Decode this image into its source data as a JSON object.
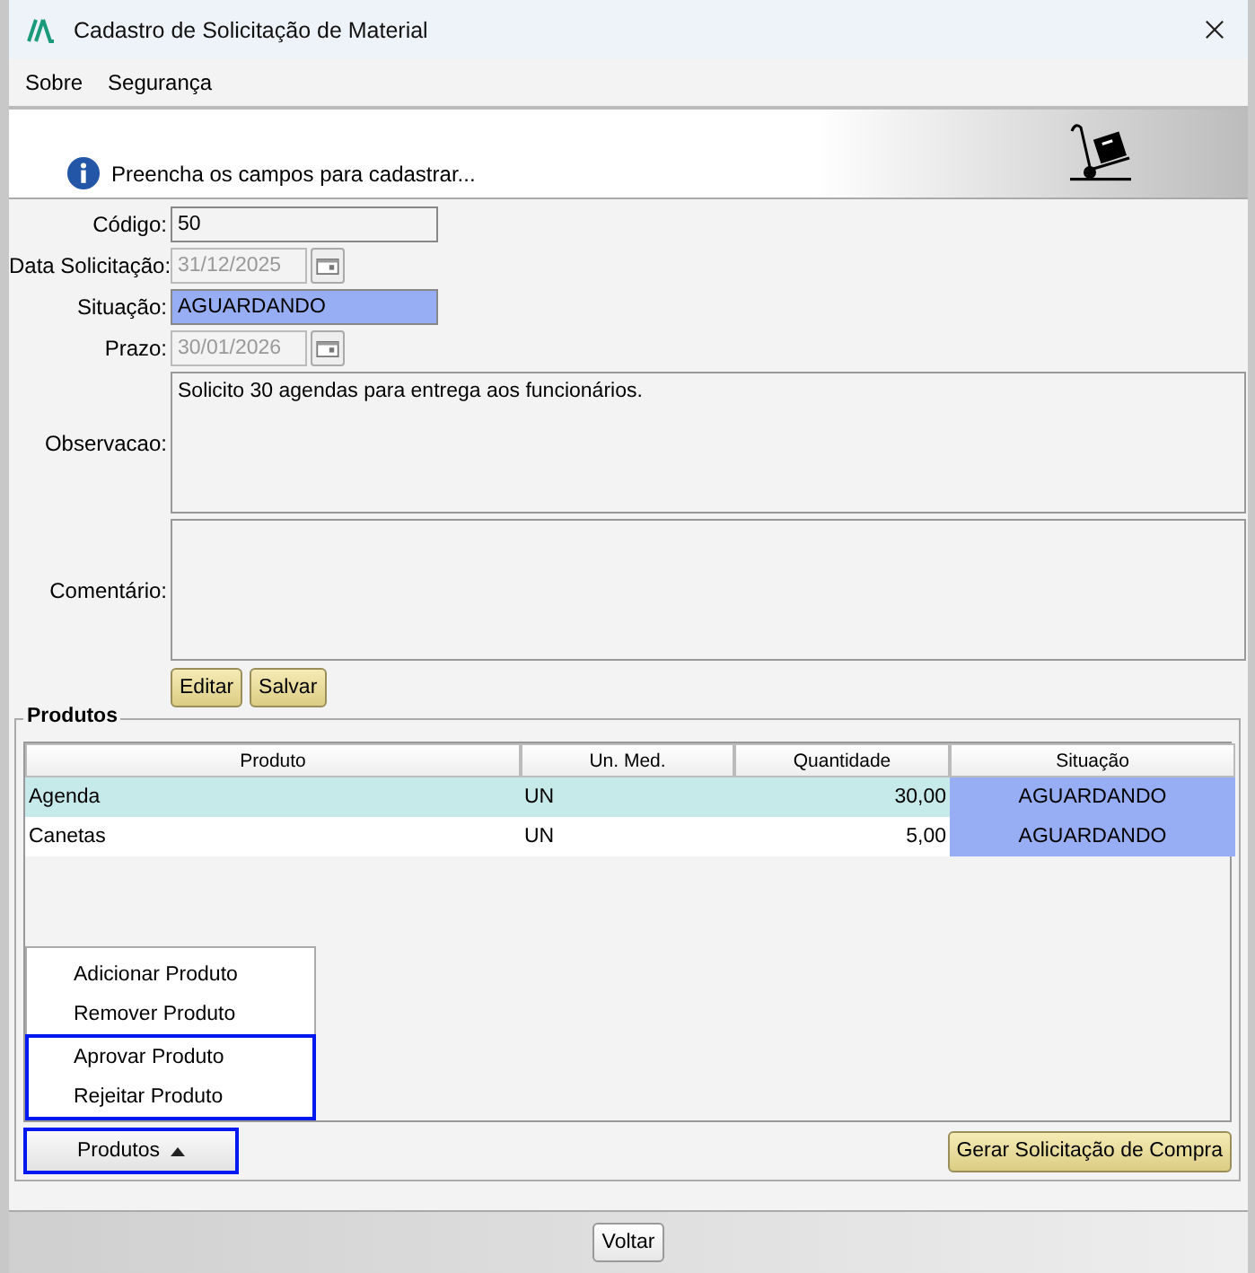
{
  "window": {
    "title": "Cadastro de Solicitação de Material"
  },
  "menu": [
    {
      "label": "Sobre"
    },
    {
      "label": "Segurança"
    }
  ],
  "banner": {
    "message": "Preencha os campos para cadastrar..."
  },
  "form": [
    {
      "label": "Código:",
      "value": "50",
      "kind": "text",
      "disabled": false
    },
    {
      "label": "Data Solicitação:",
      "value": "31/12/2025",
      "kind": "date",
      "disabled": true
    },
    {
      "label": "Situação:",
      "value": "AGUARDANDO",
      "kind": "status",
      "disabled": false
    },
    {
      "label": "Prazo:",
      "value": "30/01/2026",
      "kind": "date",
      "disabled": true
    },
    {
      "label": "Observacao:",
      "value": "Solicito 30 agendas para entrega aos funcionários.",
      "kind": "area"
    },
    {
      "label": "Comentário:",
      "kind": "area"
    }
  ],
  "form_buttons": [
    "Editar",
    "Salvar"
  ],
  "products": {
    "title": "Produtos",
    "columns": [
      "Produto",
      "Un. Med.",
      "Quantidade",
      "Situação"
    ],
    "rows": [
      {
        "cells": [
          "Agenda",
          "UN",
          "30,00",
          "AGUARDANDO"
        ],
        "selected": true
      },
      {
        "cells": [
          "Canetas",
          "UN",
          "5,00",
          "AGUARDANDO"
        ],
        "selected": false
      }
    ],
    "menu": [
      {
        "label": "Adicionar Produto",
        "highlighted": false
      },
      {
        "label": "Remover Produto",
        "highlighted": false
      },
      {
        "label": "Aprovar Produto",
        "highlighted": true
      },
      {
        "label": "Rejeitar Produto",
        "highlighted": true
      }
    ],
    "menu_button": {
      "label": "Produtos",
      "highlighted": true
    },
    "action": "Gerar Solicitação de Compra"
  },
  "footer_button": "Voltar"
}
